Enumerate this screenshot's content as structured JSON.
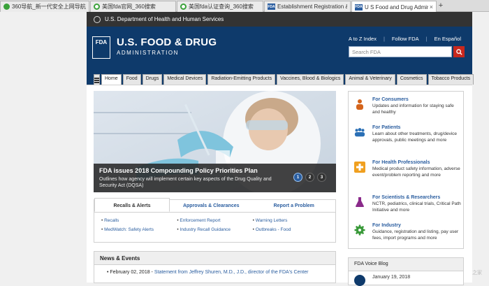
{
  "browser": {
    "tabs": [
      {
        "label": "360导航_新一代安全上网导航",
        "icon": "globe-icon",
        "color": "#3aa23a"
      },
      {
        "label": "美国fda官网_360搜索",
        "icon": "search-360-icon",
        "color": "#3aa23a"
      },
      {
        "label": "美国fda认证查询_360搜索",
        "icon": "search-360-icon",
        "color": "#3aa23a"
      },
      {
        "label": "Establishment Registration &",
        "icon": "fda-favicon",
        "color": "#2a5d9f"
      },
      {
        "label": "U S Food and Drug Administ",
        "icon": "fda-favicon",
        "color": "#2a5d9f"
      }
    ],
    "new_tab": "+",
    "close": "×"
  },
  "hhs": {
    "text": "U.S. Department of Health and Human Services"
  },
  "header": {
    "logo_mark": "FDA",
    "title": "U.S. FOOD & DRUG",
    "subtitle": "ADMINISTRATION",
    "links": [
      "A to Z Index",
      "Follow FDA",
      "En Español"
    ],
    "search_placeholder": "Search FDA"
  },
  "nav": {
    "items": [
      "Home",
      "Food",
      "Drugs",
      "Medical Devices",
      "Radiation-Emitting Products",
      "Vaccines, Blood & Biologics",
      "Animal & Veterinary",
      "Cosmetics",
      "Tobacco Products"
    ]
  },
  "hero": {
    "title": "FDA issues 2018 Compounding Policy Priorities Plan",
    "desc": "Outlines how agency will implement certain key aspects of the Drug Quality and Security Act (DQSA)",
    "pages": [
      "1",
      "2",
      "3"
    ]
  },
  "recalls": {
    "tabs": [
      "Recalls & Alerts",
      "Approvals & Clearances",
      "Report a Problem"
    ],
    "links": [
      "Recalls",
      "Enforcement Report",
      "Warning Letters",
      "MedWatch: Safety Alerts",
      "Industry Recall Guidance",
      "Outbreaks - Food"
    ]
  },
  "news": {
    "heading": "News & Events",
    "items": [
      {
        "date": "February 02, 2018 - ",
        "text": "Statement from Jeffrey Shuren, M.D., J.D., director of the FDA's Center"
      }
    ]
  },
  "audiences": [
    {
      "title": "For Consumers",
      "desc": "Updates and information for staying safe and healthy",
      "icon": "person-icon",
      "color": "#d4641c"
    },
    {
      "title": "For Patients",
      "desc": "Learn about other treatments, drug/device approvals, public meetings and more",
      "icon": "group-icon",
      "color": "#2a6fb5"
    },
    {
      "title": "For Health Professionals",
      "desc": "Medical product safety information, adverse event/problem reporting and more",
      "icon": "medical-cross-icon",
      "color": "#f0a020"
    },
    {
      "title": "For Scientists & Researchers",
      "desc": "NCTR, pediatrics, clinical trials, Critical Path Initiative and more",
      "icon": "flask-icon",
      "color": "#8a2a8a"
    },
    {
      "title": "For Industry",
      "desc": "Guidance, registration and listing, pay user fees, import programs and more",
      "icon": "gear-icon",
      "color": "#3a9a3a"
    }
  ],
  "blog": {
    "heading": "FDA Voice Blog",
    "date": "January 19, 2018"
  },
  "watermark": "之家"
}
